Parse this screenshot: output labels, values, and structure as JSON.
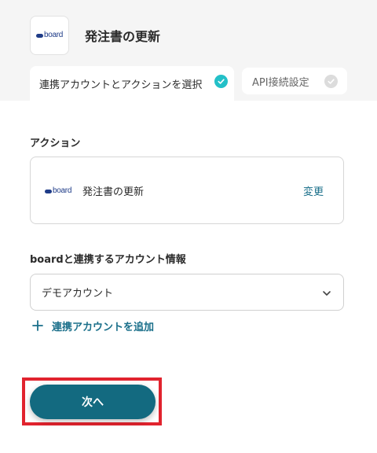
{
  "header": {
    "app_logo_text": "board",
    "title": "発注書の更新"
  },
  "tabs": [
    {
      "label": "連携アカウントとアクションを選択",
      "state": "completed",
      "check_color": "#23c0c8"
    },
    {
      "label": "API接続設定",
      "state": "pending",
      "check_color": "#dcdcdc"
    }
  ],
  "action_section": {
    "label": "アクション",
    "card": {
      "logo_text": "board",
      "action_name": "発注書の更新",
      "change_label": "変更"
    }
  },
  "account_section": {
    "label": "boardと連携するアカウント情報",
    "selected": "デモアカウント",
    "add_account_label": "連携アカウントを追加"
  },
  "footer": {
    "next_label": "次へ",
    "highlight_color": "#e1232e",
    "button_color": "#136a80"
  },
  "icons": {
    "check": "check-icon",
    "chevron": "chevron-down-icon",
    "plus": "plus-icon"
  }
}
